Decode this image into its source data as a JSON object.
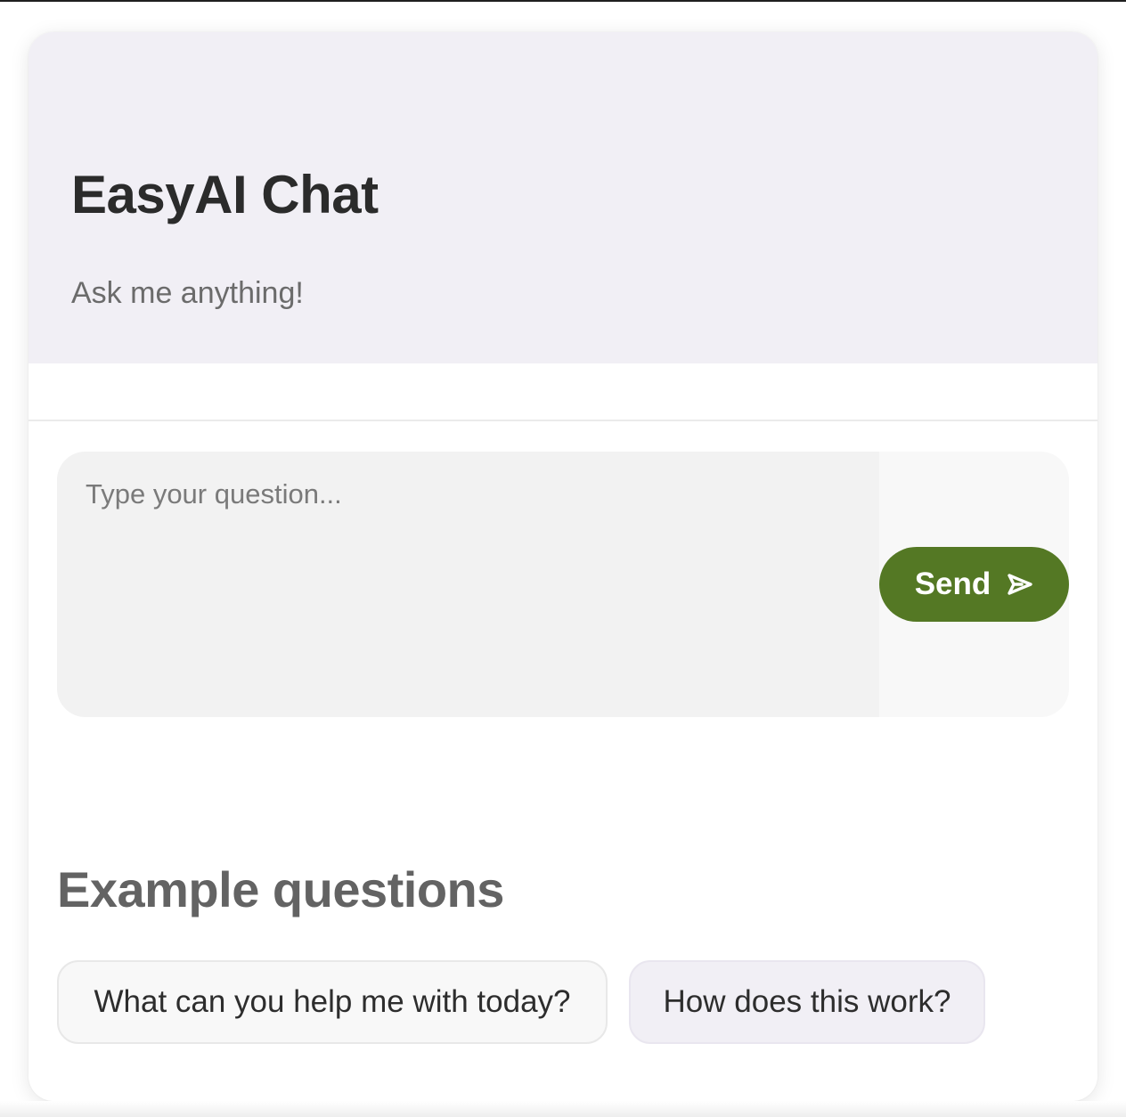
{
  "header": {
    "title": "EasyAI Chat",
    "subtitle": "Ask me anything!"
  },
  "composer": {
    "placeholder": "Type your question...",
    "value": "",
    "send_label": "Send",
    "send_icon": "send-arrow-icon"
  },
  "examples": {
    "heading": "Example questions",
    "items": [
      {
        "label": "What can you help me with today?"
      },
      {
        "label": "How does this work?"
      }
    ]
  },
  "colors": {
    "header_bg": "#f1eff5",
    "accent": "#547824",
    "title_text": "#2b2b2b",
    "subtitle_text": "#6b6b6b"
  }
}
